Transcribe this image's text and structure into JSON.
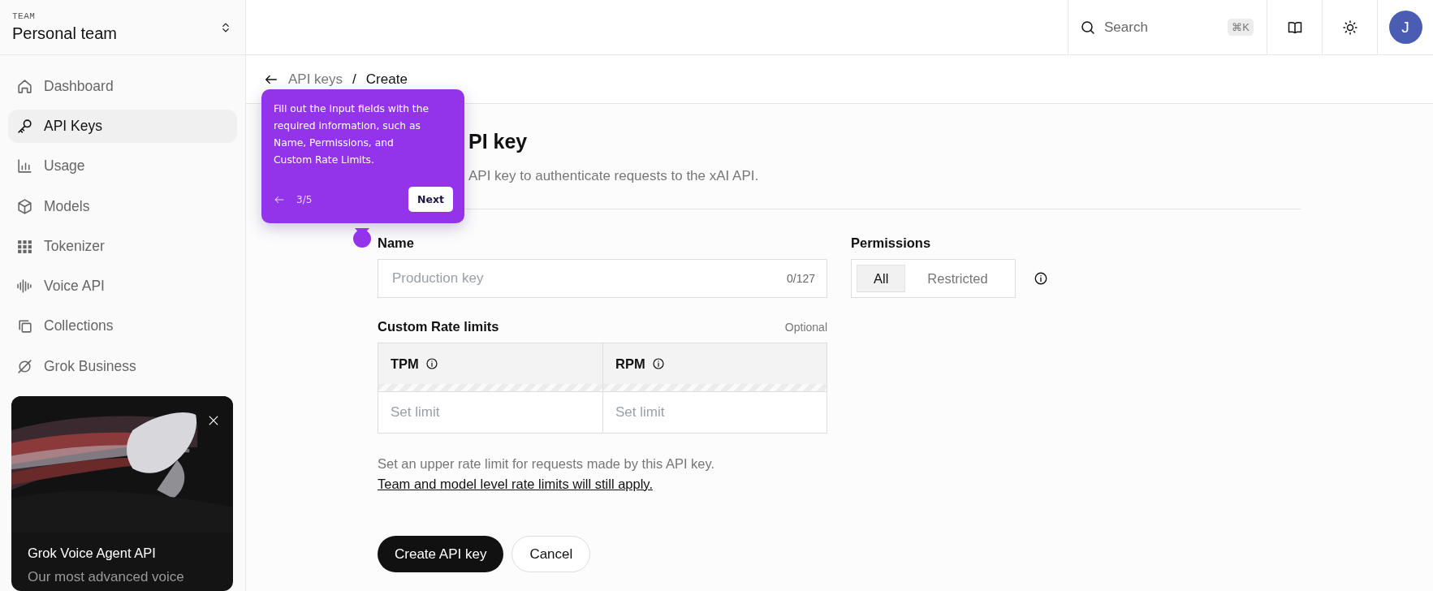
{
  "team": {
    "label": "TEAM",
    "name": "Personal team"
  },
  "nav": [
    {
      "label": "Dashboard",
      "selected": false
    },
    {
      "label": "API Keys",
      "selected": true
    },
    {
      "label": "Usage",
      "selected": false
    },
    {
      "label": "Models",
      "selected": false
    },
    {
      "label": "Tokenizer",
      "selected": false
    },
    {
      "label": "Voice API",
      "selected": false
    },
    {
      "label": "Collections",
      "selected": false
    },
    {
      "label": "Grok Business",
      "selected": false
    }
  ],
  "promo": {
    "title": "Grok Voice Agent API",
    "text": "Our most advanced voice"
  },
  "topbar": {
    "search": {
      "placeholder": "Search",
      "shortcut": "⌘K"
    },
    "avatar": "J"
  },
  "breadcrumb": {
    "items": [
      "API keys",
      "Create"
    ],
    "separator": "/"
  },
  "tour": {
    "text": "Fill out the input fields with the\nrequired information, such as\nName, Permissions, and\nCustom Rate Limits.",
    "step": "3/5",
    "button": "Next"
  },
  "page": {
    "title": "PI key",
    "description": "API key to authenticate requests to the xAI API."
  },
  "form": {
    "name": {
      "label": "Name",
      "placeholder": "Production key",
      "counter": "0/127"
    },
    "permissions": {
      "label": "Permissions",
      "options": [
        {
          "label": "All",
          "selected": true
        },
        {
          "label": "Restricted",
          "selected": false
        }
      ]
    },
    "rate_limits": {
      "title": "Custom Rate limits",
      "note": "Optional",
      "columns": [
        {
          "label": "TPM",
          "placeholder": "Set limit"
        },
        {
          "label": "RPM",
          "placeholder": "Set limit"
        }
      ],
      "help": "Set an upper rate limit for requests made by this API key.",
      "link": "Team and model level rate limits will still apply."
    },
    "buttons": [
      {
        "label": "Create API key",
        "kind": "primary"
      },
      {
        "label": "Cancel",
        "kind": "secondary"
      }
    ]
  }
}
